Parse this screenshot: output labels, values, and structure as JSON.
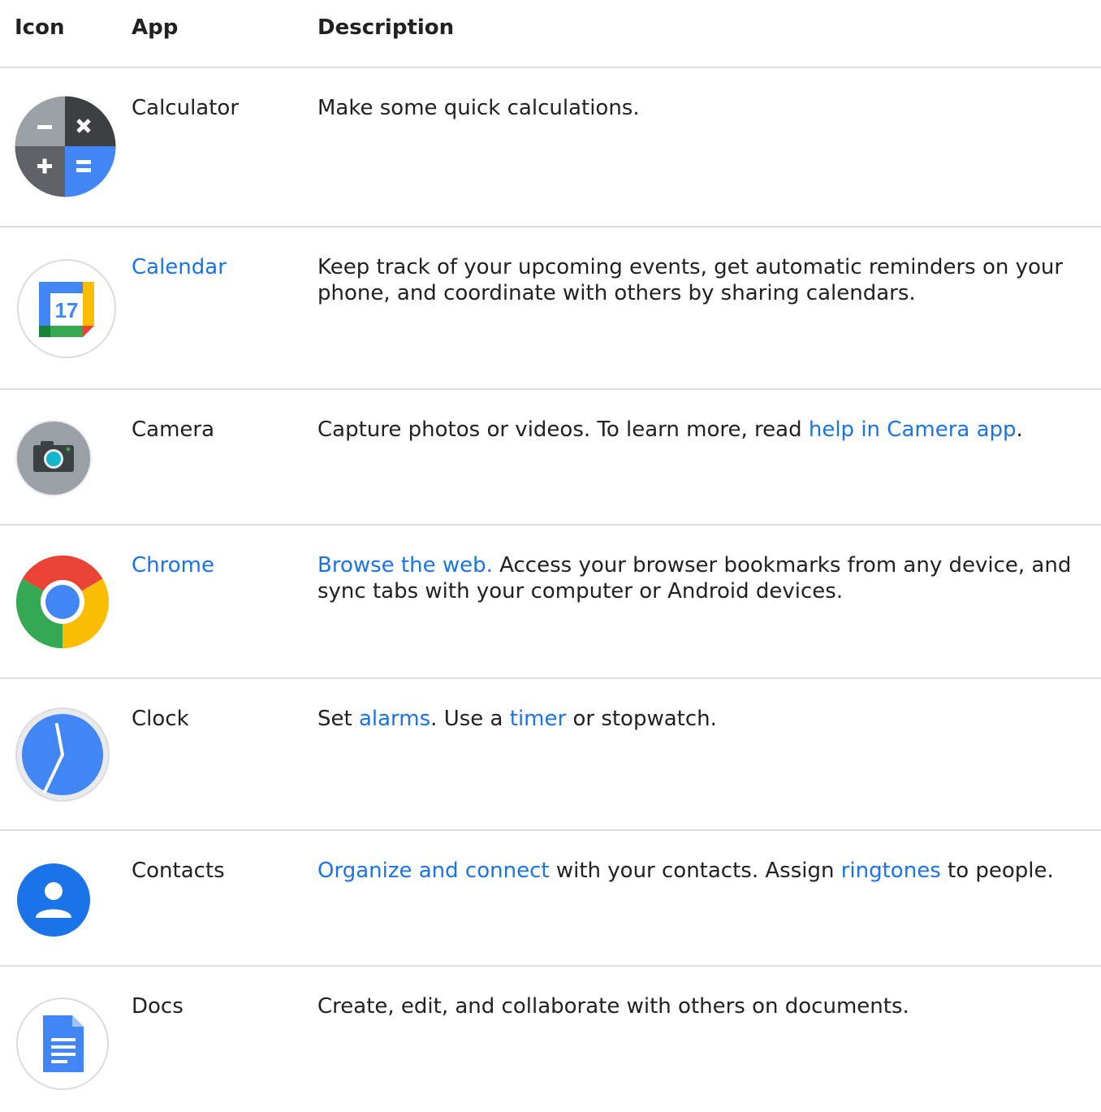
{
  "header": {
    "icon": "Icon",
    "app": "App",
    "description": "Description"
  },
  "colors": {
    "link": "#1a73e8",
    "text": "#202124",
    "divider": "#dadce0"
  },
  "rows": [
    {
      "icon": "calculator-icon",
      "name": "Calculator",
      "desc": {
        "t1": "Make some quick calculations."
      }
    },
    {
      "icon": "calendar-icon",
      "name": "Calendar",
      "icon_text": "17",
      "desc": {
        "t1": "Keep track of your upcoming events, get automatic reminders on your phone, and coordinate with others by sharing calendars."
      }
    },
    {
      "icon": "camera-icon",
      "name": "Camera",
      "desc": {
        "t1": "Capture photos or videos. To learn more, read ",
        "l1": "help in Camera app",
        "t2": "."
      }
    },
    {
      "icon": "chrome-icon",
      "name": "Chrome",
      "desc": {
        "l1": "Browse the web.",
        "t1": " Access your browser bookmarks from any device, and sync tabs with your computer or Android devices."
      }
    },
    {
      "icon": "clock-icon",
      "name": "Clock",
      "desc": {
        "t1": "Set ",
        "l1": "alarms",
        "t2": ". Use a ",
        "l2": "timer",
        "t3": " or stopwatch."
      }
    },
    {
      "icon": "contacts-icon",
      "name": "Contacts",
      "desc": {
        "l1": "Organize and connect",
        "t1": " with your contacts. Assign ",
        "l2": "ringtones",
        "t2": " to people."
      }
    },
    {
      "icon": "docs-icon",
      "name": "Docs",
      "desc": {
        "t1": "Create, edit, and collaborate with others on documents."
      }
    }
  ]
}
